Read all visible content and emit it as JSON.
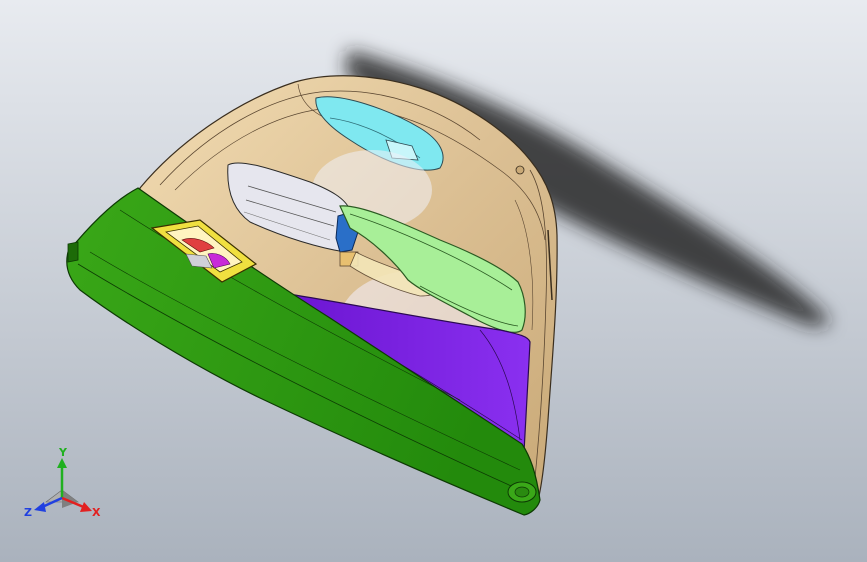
{
  "viewport": {
    "background_top": "#e8ebf0",
    "background_bottom": "#aab2bd"
  },
  "model": {
    "colors": {
      "trim_panel": "#dcc094",
      "trim_panel_light": "#ead2a6",
      "trim_edge": "#3a2e1e",
      "lower_band": "#2f9413",
      "lower_band_dark": "#1d6b08",
      "pocket": "#7a1fe0",
      "armrest": "#a8ef98",
      "window_opening": "#7fe8f0",
      "handle_cup": "#e8e8f2",
      "switch_bezel": "#f0e040",
      "speaker_magenta": "#c82ad8",
      "speaker_red": "#e04040",
      "clip_blue": "#2a6fc8"
    }
  },
  "triad": {
    "x_label": "X",
    "y_label": "Y",
    "z_label": "Z",
    "x_color": "#e22020",
    "y_color": "#20b020",
    "z_color": "#2040e0"
  }
}
